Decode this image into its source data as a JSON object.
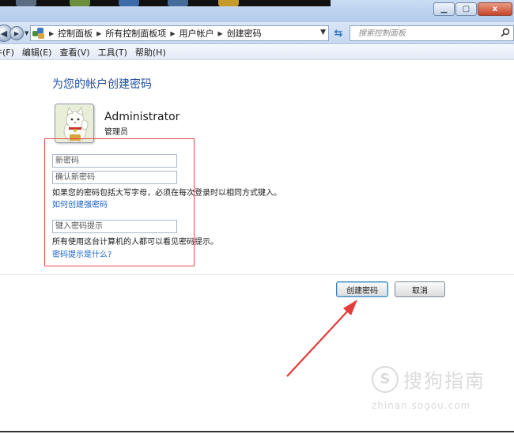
{
  "window": {
    "minimize_icon": "minimize-icon",
    "maximize_icon": "maximize-icon",
    "close_label": "x"
  },
  "address_bar": {
    "breadcrumbs": [
      "控制面板",
      "所有控制面板项",
      "用户帐户",
      "创建密码"
    ],
    "search_placeholder": "搜索控制面板"
  },
  "menu": [
    "件(F)",
    "编辑(E)",
    "查看(V)",
    "工具(T)",
    "帮助(H)"
  ],
  "content": {
    "title": "为您的帐户创建密码",
    "user_name": "Administrator",
    "user_role": "管理员",
    "new_password_placeholder": "新密码",
    "confirm_password_placeholder": "确认新密码",
    "case_note": "如果您的密码包括大写字母，必须在每次登录时以相同方式键入。",
    "strong_password_link": "如何创建强密码",
    "hint_placeholder": "键入密码提示",
    "hint_note": "所有使用这台计算机的人都可以看见密码提示。",
    "hint_link": "密码提示是什么?"
  },
  "buttons": {
    "create": "创建密码",
    "cancel": "取消"
  },
  "watermark": {
    "mark": "S",
    "name": "搜狗指南",
    "url": "zhinan.sogou.com"
  },
  "colors": {
    "highlight_box": "#e84a4a",
    "arrow": "#e53b3b",
    "link": "#1a63c7",
    "title": "#1e4e9e"
  }
}
